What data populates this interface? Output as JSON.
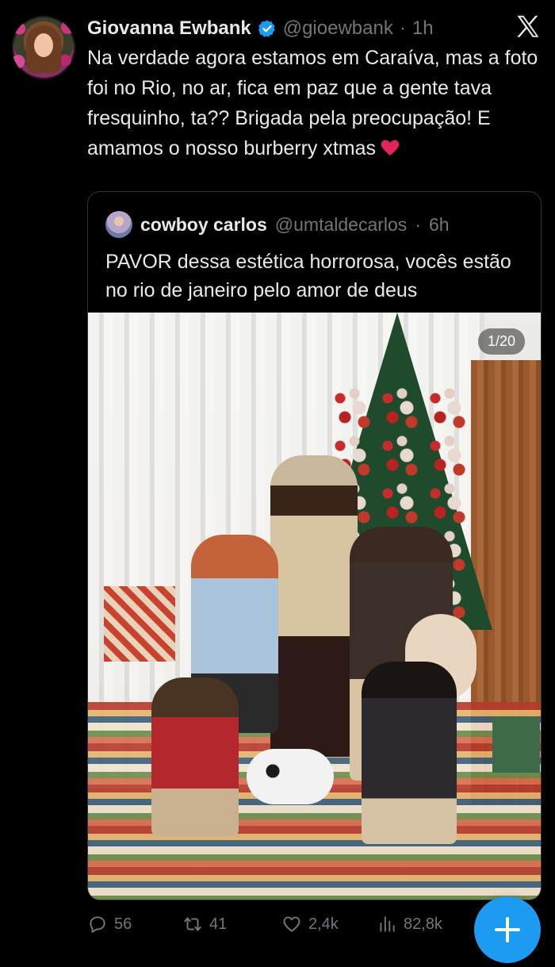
{
  "tweet": {
    "author_name": "Giovanna Ewbank",
    "handle": "@gioewbank",
    "time": "1h",
    "text": "Na verdade agora estamos em Caraíva, mas a foto foi no Rio, no ar, fica em paz que a gente tava fresquinho, ta?? Brigada pela preocupação! E amamos o nosso burberry xtmas"
  },
  "quote": {
    "author_name": "cowboy carlos",
    "handle": "@umtaldecarlos",
    "time": "6h",
    "text": "PAVOR dessa estética horrorosa, vocês estão no rio de janeiro pelo amor de deus",
    "photo_counter": "1/20"
  },
  "actions": {
    "replies": "56",
    "retweets": "41",
    "likes": "2,4k",
    "views": "82,8k"
  },
  "icons": {
    "verified": "verified-badge-icon",
    "logo": "x-logo-icon",
    "reply": "reply-icon",
    "retweet": "retweet-icon",
    "like": "heart-icon",
    "views": "views-icon",
    "share": "share-icon",
    "mute": "mute-icon",
    "person": "person-icon"
  },
  "colors": {
    "background": "#000000",
    "text": "#e7e9ea",
    "muted": "#71767b",
    "accent": "#1d9bf0",
    "border": "#2f3336",
    "heart": "#e0245e"
  }
}
